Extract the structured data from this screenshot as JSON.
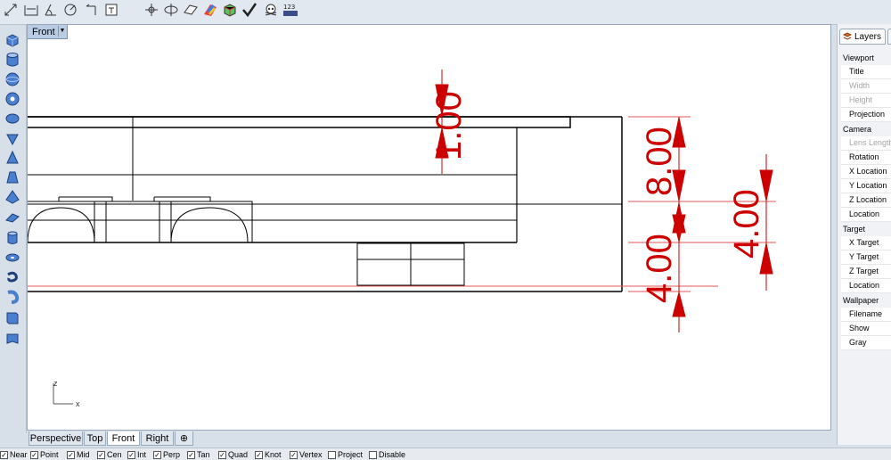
{
  "toolbar": {
    "icons": [
      "dim-aligned-icon",
      "dim-linear-icon",
      "dim-angle-icon",
      "dim-radius-icon",
      "dim-leader-icon",
      "text-icon",
      "snap-icon",
      "rotate-view-icon",
      "plane-icon",
      "color-icon",
      "box-color-icon",
      "check-icon",
      "skull-icon",
      "numbers-icon"
    ]
  },
  "left_toolbar": {
    "icons": [
      "box-icon",
      "cylinder-icon",
      "sphere-icon",
      "torus-icon",
      "ellipsoid-icon",
      "cone-icon",
      "pyramid-icon",
      "truncated-cone-icon",
      "tetra-icon",
      "wedge-icon",
      "pipe-icon",
      "disk-icon",
      "spring-icon",
      "ribbon-icon",
      "box-edit-icon",
      "flag-icon"
    ]
  },
  "viewport": {
    "title": "Front",
    "axis_labels": {
      "z": "z",
      "x": "x"
    }
  },
  "dimensions": {
    "top": "1.00",
    "right_large": "8.00",
    "right_bottom": "4.00",
    "far_right": "4.00"
  },
  "colors": {
    "dimension": "#cc0000",
    "construction": "#e05a5a",
    "geometry": "#000000"
  },
  "view_tabs": [
    {
      "label": "Perspective",
      "active": false
    },
    {
      "label": "Top",
      "active": false
    },
    {
      "label": "Front",
      "active": true
    },
    {
      "label": "Right",
      "active": false
    }
  ],
  "osnaps": [
    {
      "label": "Near",
      "checked": true
    },
    {
      "label": "Point",
      "checked": true
    },
    {
      "label": "Mid",
      "checked": true
    },
    {
      "label": "Cen",
      "checked": true
    },
    {
      "label": "Int",
      "checked": true
    },
    {
      "label": "Perp",
      "checked": true
    },
    {
      "label": "Tan",
      "checked": true
    },
    {
      "label": "Quad",
      "checked": true
    },
    {
      "label": "Knot",
      "checked": true
    },
    {
      "label": "Vertex",
      "checked": true
    },
    {
      "label": "Project",
      "checked": false
    },
    {
      "label": "Disable",
      "checked": false
    }
  ],
  "panel": {
    "tab": "Layers",
    "sections": [
      {
        "title": "Viewport",
        "rows": [
          {
            "label": "Title",
            "enabled": true
          },
          {
            "label": "Width",
            "enabled": false
          },
          {
            "label": "Height",
            "enabled": false
          },
          {
            "label": "Projection",
            "enabled": true
          }
        ]
      },
      {
        "title": "Camera",
        "rows": [
          {
            "label": "Lens Length",
            "enabled": false
          },
          {
            "label": "Rotation",
            "enabled": true
          },
          {
            "label": "X Location",
            "enabled": true
          },
          {
            "label": "Y Location",
            "enabled": true
          },
          {
            "label": "Z Location",
            "enabled": true
          },
          {
            "label": "Location",
            "enabled": true
          }
        ]
      },
      {
        "title": "Target",
        "rows": [
          {
            "label": "X Target",
            "enabled": true
          },
          {
            "label": "Y Target",
            "enabled": true
          },
          {
            "label": "Z Target",
            "enabled": true
          },
          {
            "label": "Location",
            "enabled": true
          }
        ]
      },
      {
        "title": "Wallpaper",
        "rows": [
          {
            "label": "Filename",
            "enabled": true
          },
          {
            "label": "Show",
            "enabled": true
          },
          {
            "label": "Gray",
            "enabled": true
          }
        ]
      }
    ]
  }
}
